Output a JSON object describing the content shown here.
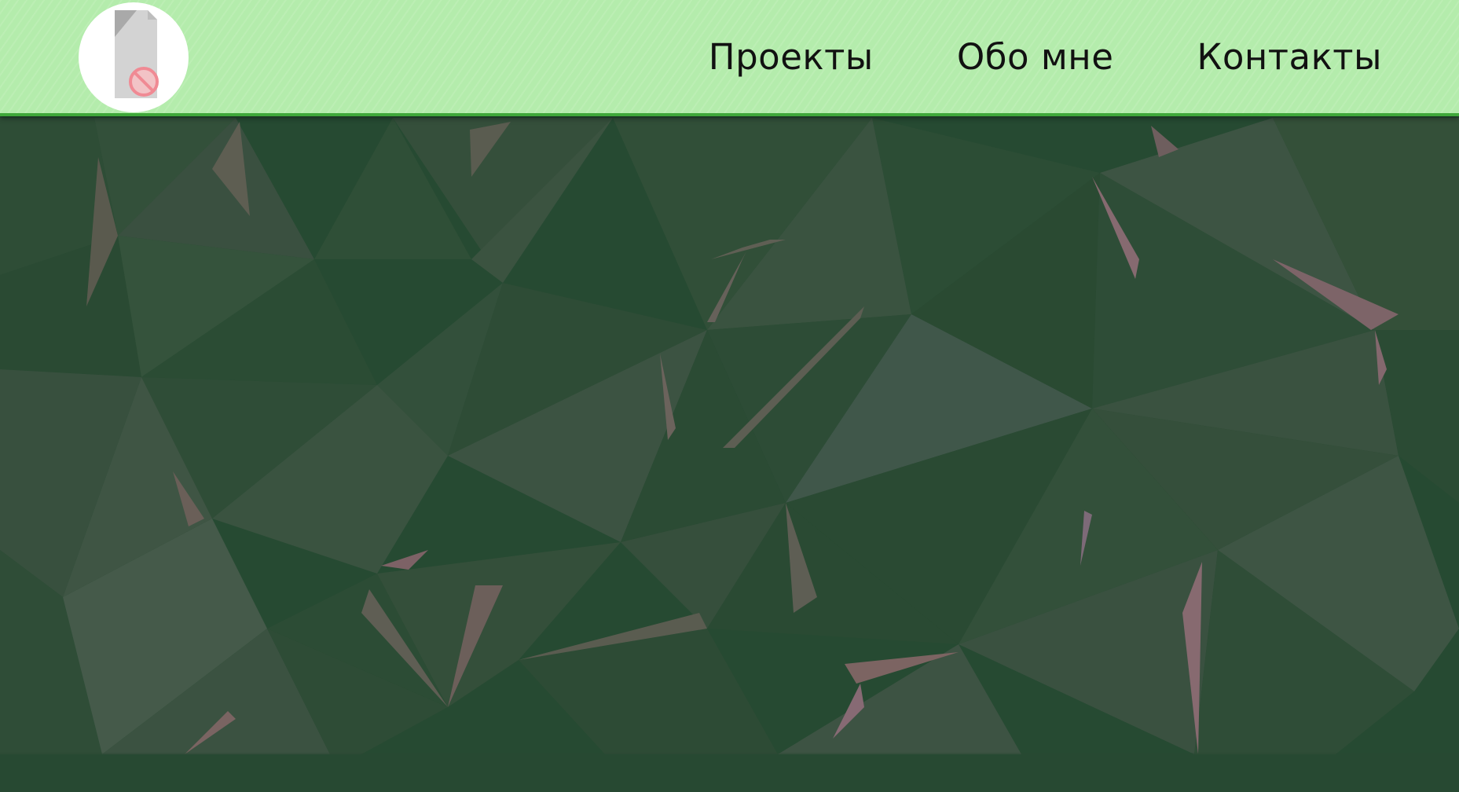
{
  "header": {
    "logo_icon": "broken-image-icon",
    "colors": {
      "background": "#b4ecac",
      "border": "#3fa83a"
    }
  },
  "nav": {
    "items": [
      {
        "label": "Проекты"
      },
      {
        "label": "Обо мне"
      },
      {
        "label": "Контакты"
      }
    ]
  },
  "hero": {
    "pattern": "low-poly-triangles",
    "colors": {
      "base": "#264a32",
      "accent_light": "#4e5e48",
      "accent_pink": "#8a6a6c"
    }
  }
}
